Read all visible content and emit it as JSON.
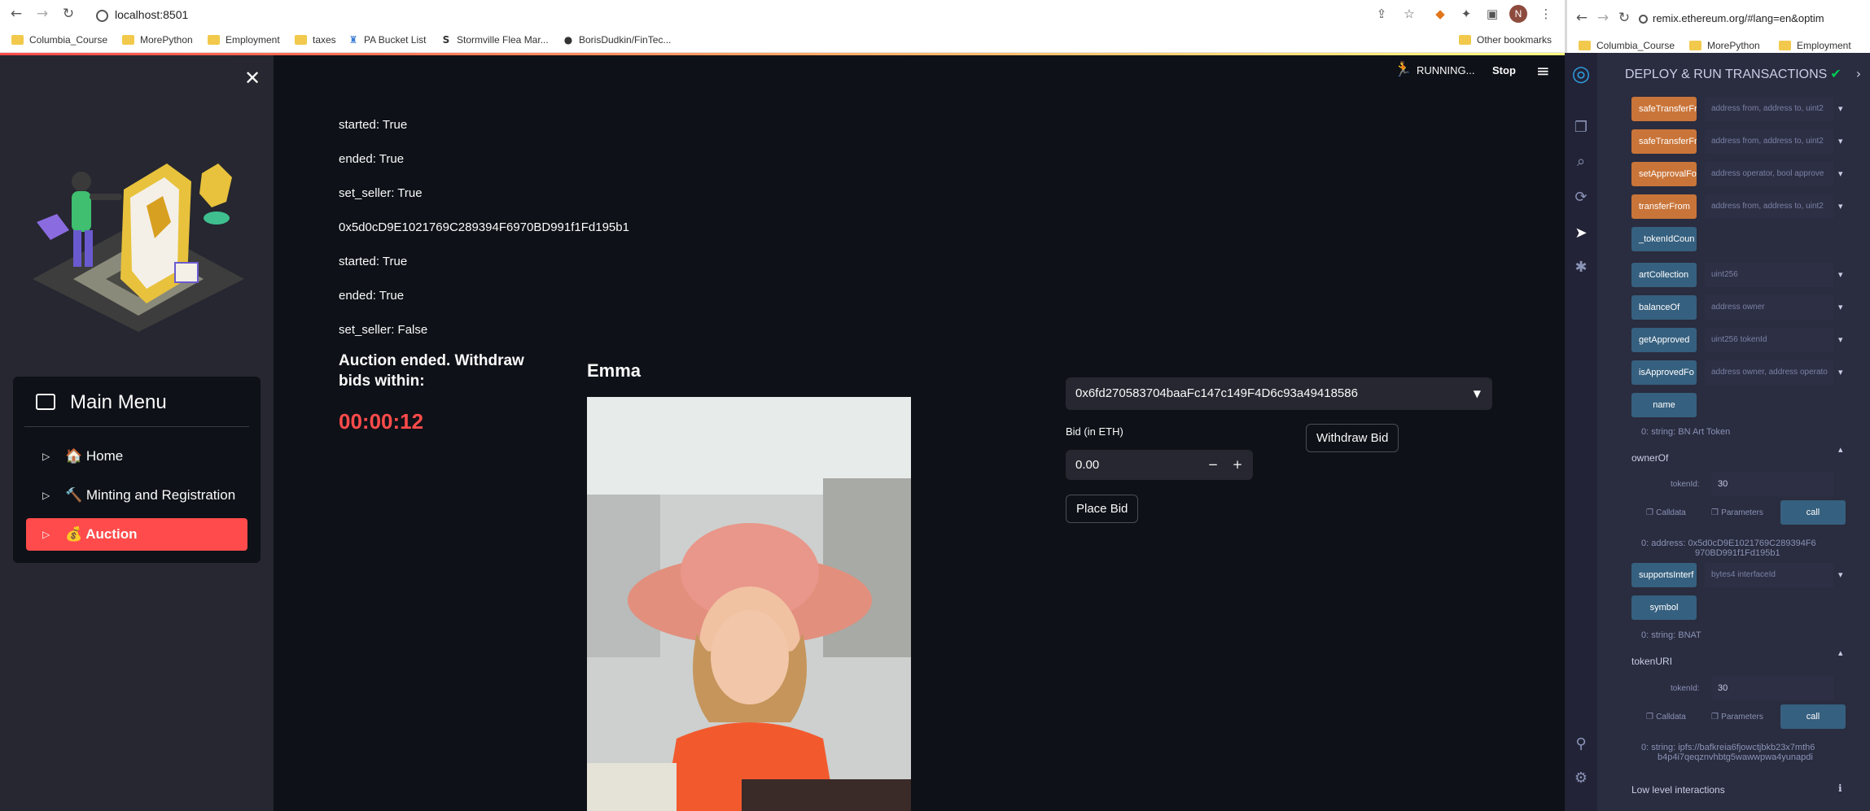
{
  "left_browser": {
    "url": "localhost:8501",
    "avatar_letter": "N",
    "bookmarks": [
      "Columbia_Course",
      "MorePython",
      "Employment",
      "taxes",
      "PA Bucket List",
      "Stormville Flea Mar...",
      "BorisDudkin/FinTec...",
      "Other bookmarks"
    ]
  },
  "app": {
    "header": {
      "running": "RUNNING...",
      "stop": "Stop"
    },
    "menu": {
      "title": "Main Menu",
      "items": [
        {
          "label": "🏠 Home"
        },
        {
          "label": "🔨 Minting and Registration"
        },
        {
          "label": "💰 Auction"
        }
      ]
    },
    "status_lines": [
      "started: True",
      "ended: True",
      "set_seller: True",
      "0x5d0cD9E1021769C289394F6970BD991f1Fd195b1",
      "started: True",
      "ended: True",
      "set_seller: False"
    ],
    "auction_msg": "Auction ended. Withdraw bids within:",
    "countdown": "00:00:12",
    "nft_name": "Emma",
    "account": "0x6fd270583704baaFc147c149F4D6c93a49418586",
    "bid_label": "Bid (in ETH)",
    "bid_value": "0.00",
    "place_bid": "Place Bid",
    "withdraw_bid": "Withdraw Bid"
  },
  "right_browser": {
    "url": "remix.ethereum.org/#lang=en&optim",
    "bookmarks": [
      "Columbia_Course",
      "MorePython",
      "Employment"
    ]
  },
  "remix": {
    "title": "DEPLOY & RUN TRANSACTIONS",
    "functions": [
      {
        "name": "safeTransferFr",
        "params": "address from, address to, uint2"
      },
      {
        "name": "safeTransferFr",
        "params": "address from, address to, uint2"
      },
      {
        "name": "setApprovalFo",
        "params": "address operator, bool approve"
      },
      {
        "name": "transferFrom",
        "params": "address from, address to, uint2"
      },
      {
        "name": "_tokenIdCoun",
        "params": ""
      },
      {
        "name": "artCollection",
        "params": "uint256"
      },
      {
        "name": "balanceOf",
        "params": "address owner"
      },
      {
        "name": "getApproved",
        "params": "uint256 tokenId"
      },
      {
        "name": "isApprovedFo",
        "params": "address owner, address operato"
      },
      {
        "name": "name",
        "params": ""
      }
    ],
    "name_result": "0: string: BN Art Token",
    "ownerOf": {
      "title": "ownerOf",
      "param_label": "tokenId:",
      "param_value": "30",
      "result_1": "0: address: 0x5d0cD9E1021769C289394F6",
      "result_2": "970BD991f1Fd195b1"
    },
    "supportsInterface": {
      "name": "supportsInterf",
      "params": "bytes4 interfaceId"
    },
    "symbol": {
      "name": "symbol",
      "result": "0: string: BNAT"
    },
    "tokenURI": {
      "title": "tokenURI",
      "param_label": "tokenId:",
      "param_value": "30",
      "result_1": "0: string: ipfs://bafkreia6fjowctjbkb23x7mth6",
      "result_2": "b4p4i7qeqznvhbtg5wawwpwa4yunapdi"
    },
    "calldata": "Calldata",
    "parameters": "Parameters",
    "call": "call",
    "low_level": "Low level interactions"
  }
}
